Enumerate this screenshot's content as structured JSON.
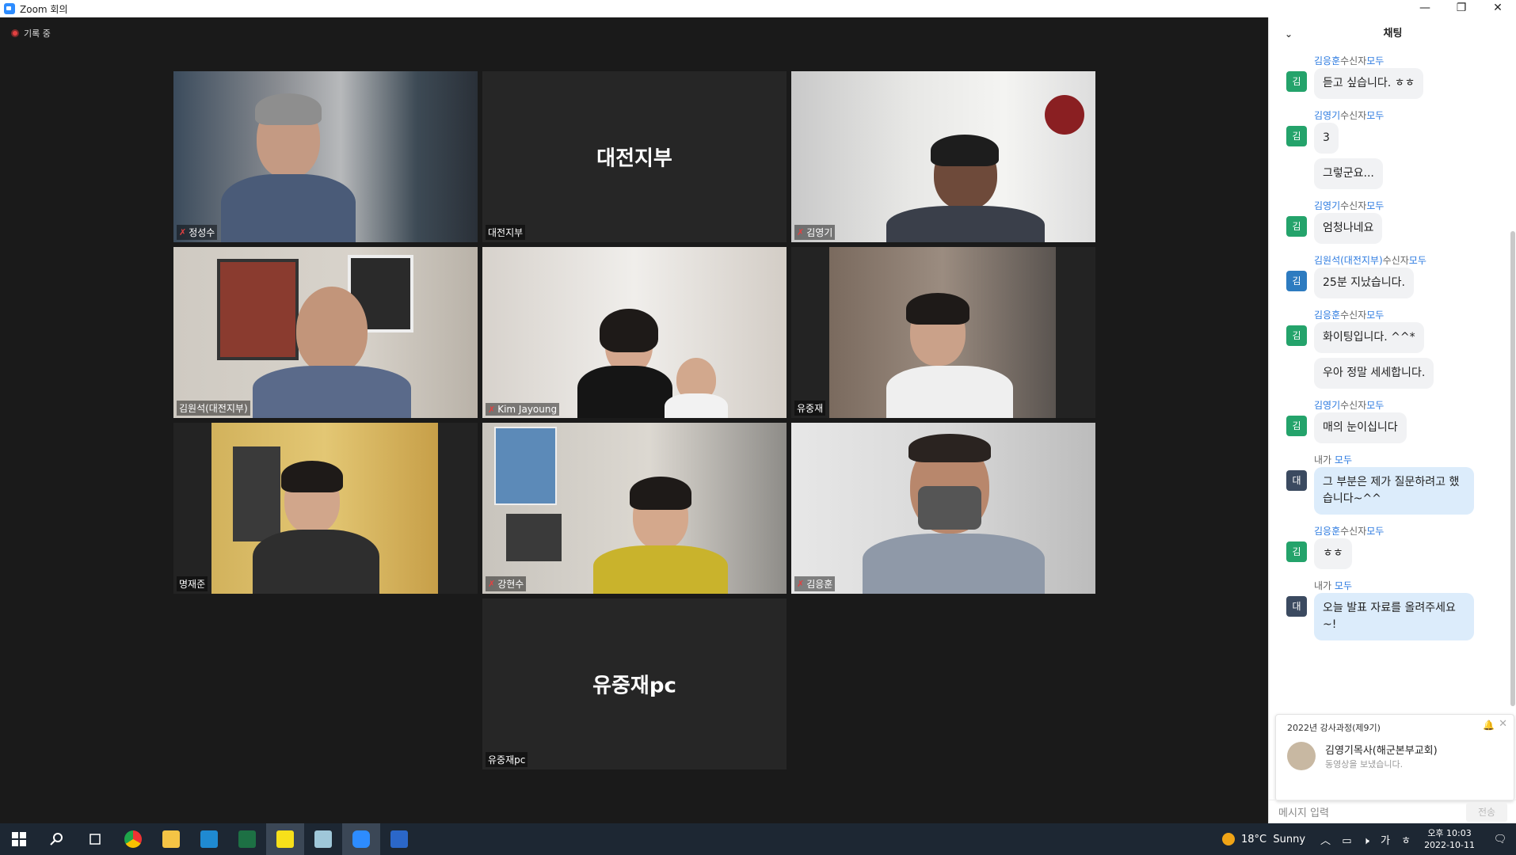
{
  "window": {
    "title": "Zoom 회의",
    "controls": [
      "—",
      "❐",
      "✕"
    ]
  },
  "recording": {
    "label": "기록 중"
  },
  "participants": [
    {
      "name": "정성수",
      "muted": true
    },
    {
      "name": "대전지부",
      "muted": false,
      "display_text": "대전지부"
    },
    {
      "name": "김영기",
      "muted": true
    },
    {
      "name": "김원석(대전지부)",
      "muted": false
    },
    {
      "name": "Kim Jayoung",
      "muted": true
    },
    {
      "name": "유중재",
      "muted": false,
      "active_speaker": true
    },
    {
      "name": "명재준",
      "muted": false
    },
    {
      "name": "강현수",
      "muted": true
    },
    {
      "name": "김응훈",
      "muted": true
    },
    {
      "name": "유중재pc",
      "muted": false,
      "display_text": "유중재pc"
    }
  ],
  "chat": {
    "title": "채팅",
    "collapse_icon": "chevron-down-icon",
    "messages": [
      {
        "sender": "김응훈",
        "recipient_label": "수신자",
        "target": "모두",
        "avatar": "김",
        "avatar_color": "#24a36b",
        "texts": [
          "듣고 싶습니다. ㅎㅎ"
        ]
      },
      {
        "sender": "김영기",
        "recipient_label": "수신자",
        "target": "모두",
        "avatar": "김",
        "avatar_color": "#24a36b",
        "texts": [
          "3",
          "그렇군요..."
        ]
      },
      {
        "sender": "김영기",
        "recipient_label": "수신자",
        "target": "모두",
        "avatar": "김",
        "avatar_color": "#24a36b",
        "texts": [
          "엄청나네요"
        ]
      },
      {
        "sender": "김원석(대전지부)",
        "recipient_label": "수신자",
        "target": "모두",
        "avatar": "김",
        "avatar_color": "#2d7bc0",
        "texts": [
          "25분 지났습니다."
        ]
      },
      {
        "sender": "김응훈",
        "recipient_label": "수신자",
        "target": "모두",
        "avatar": "김",
        "avatar_color": "#24a36b",
        "texts": [
          "화이팅입니다. ^^*",
          "우아 정말 세세합니다."
        ]
      },
      {
        "sender": "김영기",
        "recipient_label": "수신자",
        "target": "모두",
        "avatar": "김",
        "avatar_color": "#24a36b",
        "texts": [
          "매의 눈이십니다"
        ]
      },
      {
        "sender": "내가",
        "recipient_label": "",
        "target": "모두",
        "avatar": "대",
        "avatar_color": "#3b4a60",
        "mine": true,
        "texts": [
          "그 부분은 제가 질문하려고 했습니다~^^"
        ]
      },
      {
        "sender": "김응훈",
        "recipient_label": "수신자",
        "target": "모두",
        "avatar": "김",
        "avatar_color": "#24a36b",
        "texts": [
          "ㅎㅎ"
        ]
      },
      {
        "sender": "내가",
        "recipient_label": "",
        "target": "모두",
        "avatar": "대",
        "avatar_color": "#3b4a60",
        "mine": true,
        "texts": [
          "오늘 발표 자료를 올려주세요~!"
        ]
      }
    ],
    "notification": {
      "title": "2022년 강사과정(제9기)",
      "sender": "김영기목사(해군본부교회)",
      "text": "동영상을 보냈습니다."
    },
    "input_placeholder": "메시지 입력",
    "send_label": "전송"
  },
  "taskbar": {
    "weather": {
      "temp": "18°C",
      "condition": "Sunny"
    },
    "ime": "가",
    "time": "오후 10:03",
    "date": "2022-10-11",
    "accent_color": "#1d2733"
  }
}
